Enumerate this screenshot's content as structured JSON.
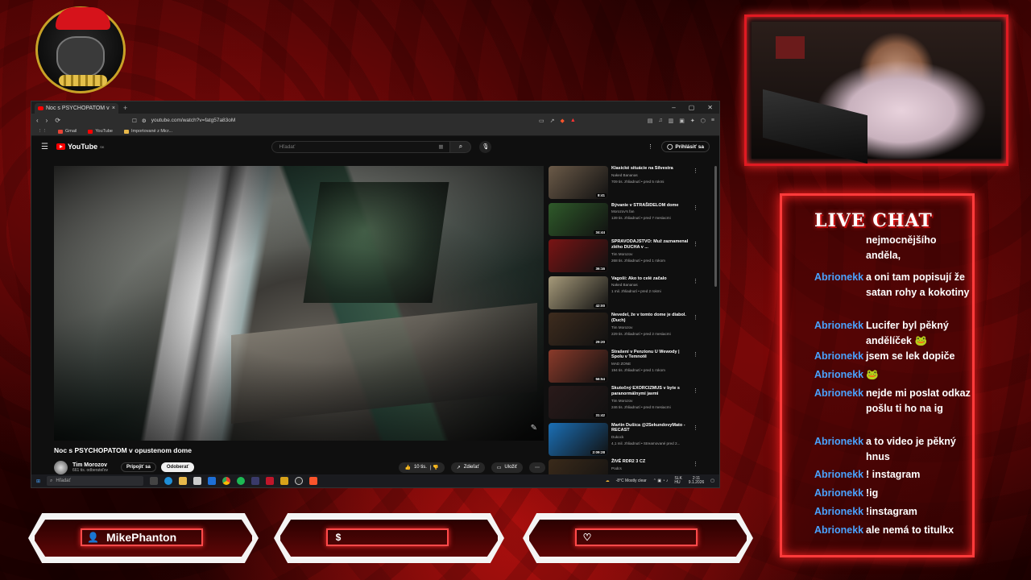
{
  "browser": {
    "tab_title": "Noc s PSYCHOPATOM v opu",
    "url": "youtube.com/watch?v=fatg57a83oM",
    "bookmarks": [
      "Gmail",
      "YouTube",
      "Importované z Micr..."
    ]
  },
  "youtube": {
    "logo": "YouTube",
    "logo_region": "SK",
    "search_placeholder": "Hľadať",
    "signin": "Prihlásiť sa",
    "video_title": "Noc s PSYCHOPATOM v opustenom dome",
    "channel_name": "Tim Morozov",
    "channel_subs": "661 tis. odberateľov",
    "join_label": "Pripojiť sa",
    "subscribe_label": "Odoberať",
    "like_count": "10 tis.",
    "share_label": "Zdieľať",
    "save_label": "Uložiť",
    "sidebar": [
      {
        "title": "Klasické situácie na Silvestra",
        "channel": "Naked Bananas",
        "meta": "709 tis. zhliadnutí • pred 5 rokmi",
        "duration": "8:41",
        "color": "#6b5a48"
      },
      {
        "title": "Bývanie v STRAŠIDELOM dome",
        "channel": "Morozov's fan",
        "meta": "139 tis. zhliadnutí • pred 7 mesiacmi",
        "duration": "34:44",
        "color": "#2f5a2a"
      },
      {
        "title": "SPRAVODAJSTVO: Muž zaznamenal zlého DUCHA v ...",
        "channel": "Tim Morozov",
        "meta": "268 tis. zhliadnutí • pred 1 rokom",
        "duration": "36:16",
        "color": "#7a1414"
      },
      {
        "title": "Vagoši: Ako to celé začalo",
        "channel": "Naked Bananas",
        "meta": "1 mil. zhliadnutí • pred 2 rokmi",
        "duration": "42:00",
        "color": "#a69a7a"
      },
      {
        "title": "Nevedel, že v tomto dome je diabol. (Duch)",
        "channel": "Tim Morozov",
        "meta": "229 tis. zhliadnutí • pred 2 mesiacmi",
        "duration": "29:20",
        "color": "#3e2c1e"
      },
      {
        "title": "Strašení v Penzionu U Wewody | Spolu v Temnotě",
        "channel": "MAD ZONE",
        "meta": "194 tis. zhliadnutí • pred 1 rokom",
        "duration": "56:54",
        "color": "#8a3a2a"
      },
      {
        "title": "Skutočný EXORCIZMUS v byte s paranormálnymi javmi",
        "channel": "Tim Morozov",
        "meta": "246 tis. zhliadnutí • pred 8 mesiacmi",
        "duration": "31:42",
        "color": "#2a1a1a"
      },
      {
        "title": "Martin Dušica @2SekundovyMato - RECAST",
        "channel": "Dukock",
        "meta": "4,1 mil. zhliadnutí • Streamované pred 2...",
        "duration": "2:09:28",
        "color": "#1b6fb5"
      },
      {
        "title": "ŽIVÉ RDR2 3 CZ",
        "channel": "Podcs",
        "meta": "",
        "duration": "",
        "color": "#3a2a1a"
      }
    ]
  },
  "taskbar": {
    "search_placeholder": "Hľadať",
    "weather": "-8°C  Mostly clear",
    "lang": "SLK\nHU",
    "time": "2:11",
    "date": "9.1.2026"
  },
  "chat": {
    "title": "LIVE CHAT",
    "messages": [
      {
        "user": "",
        "text": "nejmocnějšího anděla,"
      },
      {
        "user": "Abrionekk",
        "text": "a oni tam popisují že satan rohy a kokotiny"
      },
      {
        "user": "Abrionekk",
        "text": "Lucifer byl pěkný andělíček 🐸"
      },
      {
        "user": "Abrionekk",
        "text": "jsem se lek dopiče"
      },
      {
        "user": "Abrionekk",
        "text": "🐸"
      },
      {
        "user": "Abrionekk",
        "text": "nejde mi poslat odkaz pošlu ti ho na ig"
      },
      {
        "user": "Abrionekk",
        "text": "a to video je pěkný hnus"
      },
      {
        "user": "Abrionekk",
        "text": "! instagram"
      },
      {
        "user": "Abrionekk",
        "text": "!ig"
      },
      {
        "user": "Abrionekk",
        "text": "!instagram"
      },
      {
        "user": "Abrionekk",
        "text": "ale nemá to titulkx"
      }
    ]
  },
  "bottom_bars": {
    "follower": "MikePhanton",
    "donation": "",
    "subscriber": ""
  }
}
